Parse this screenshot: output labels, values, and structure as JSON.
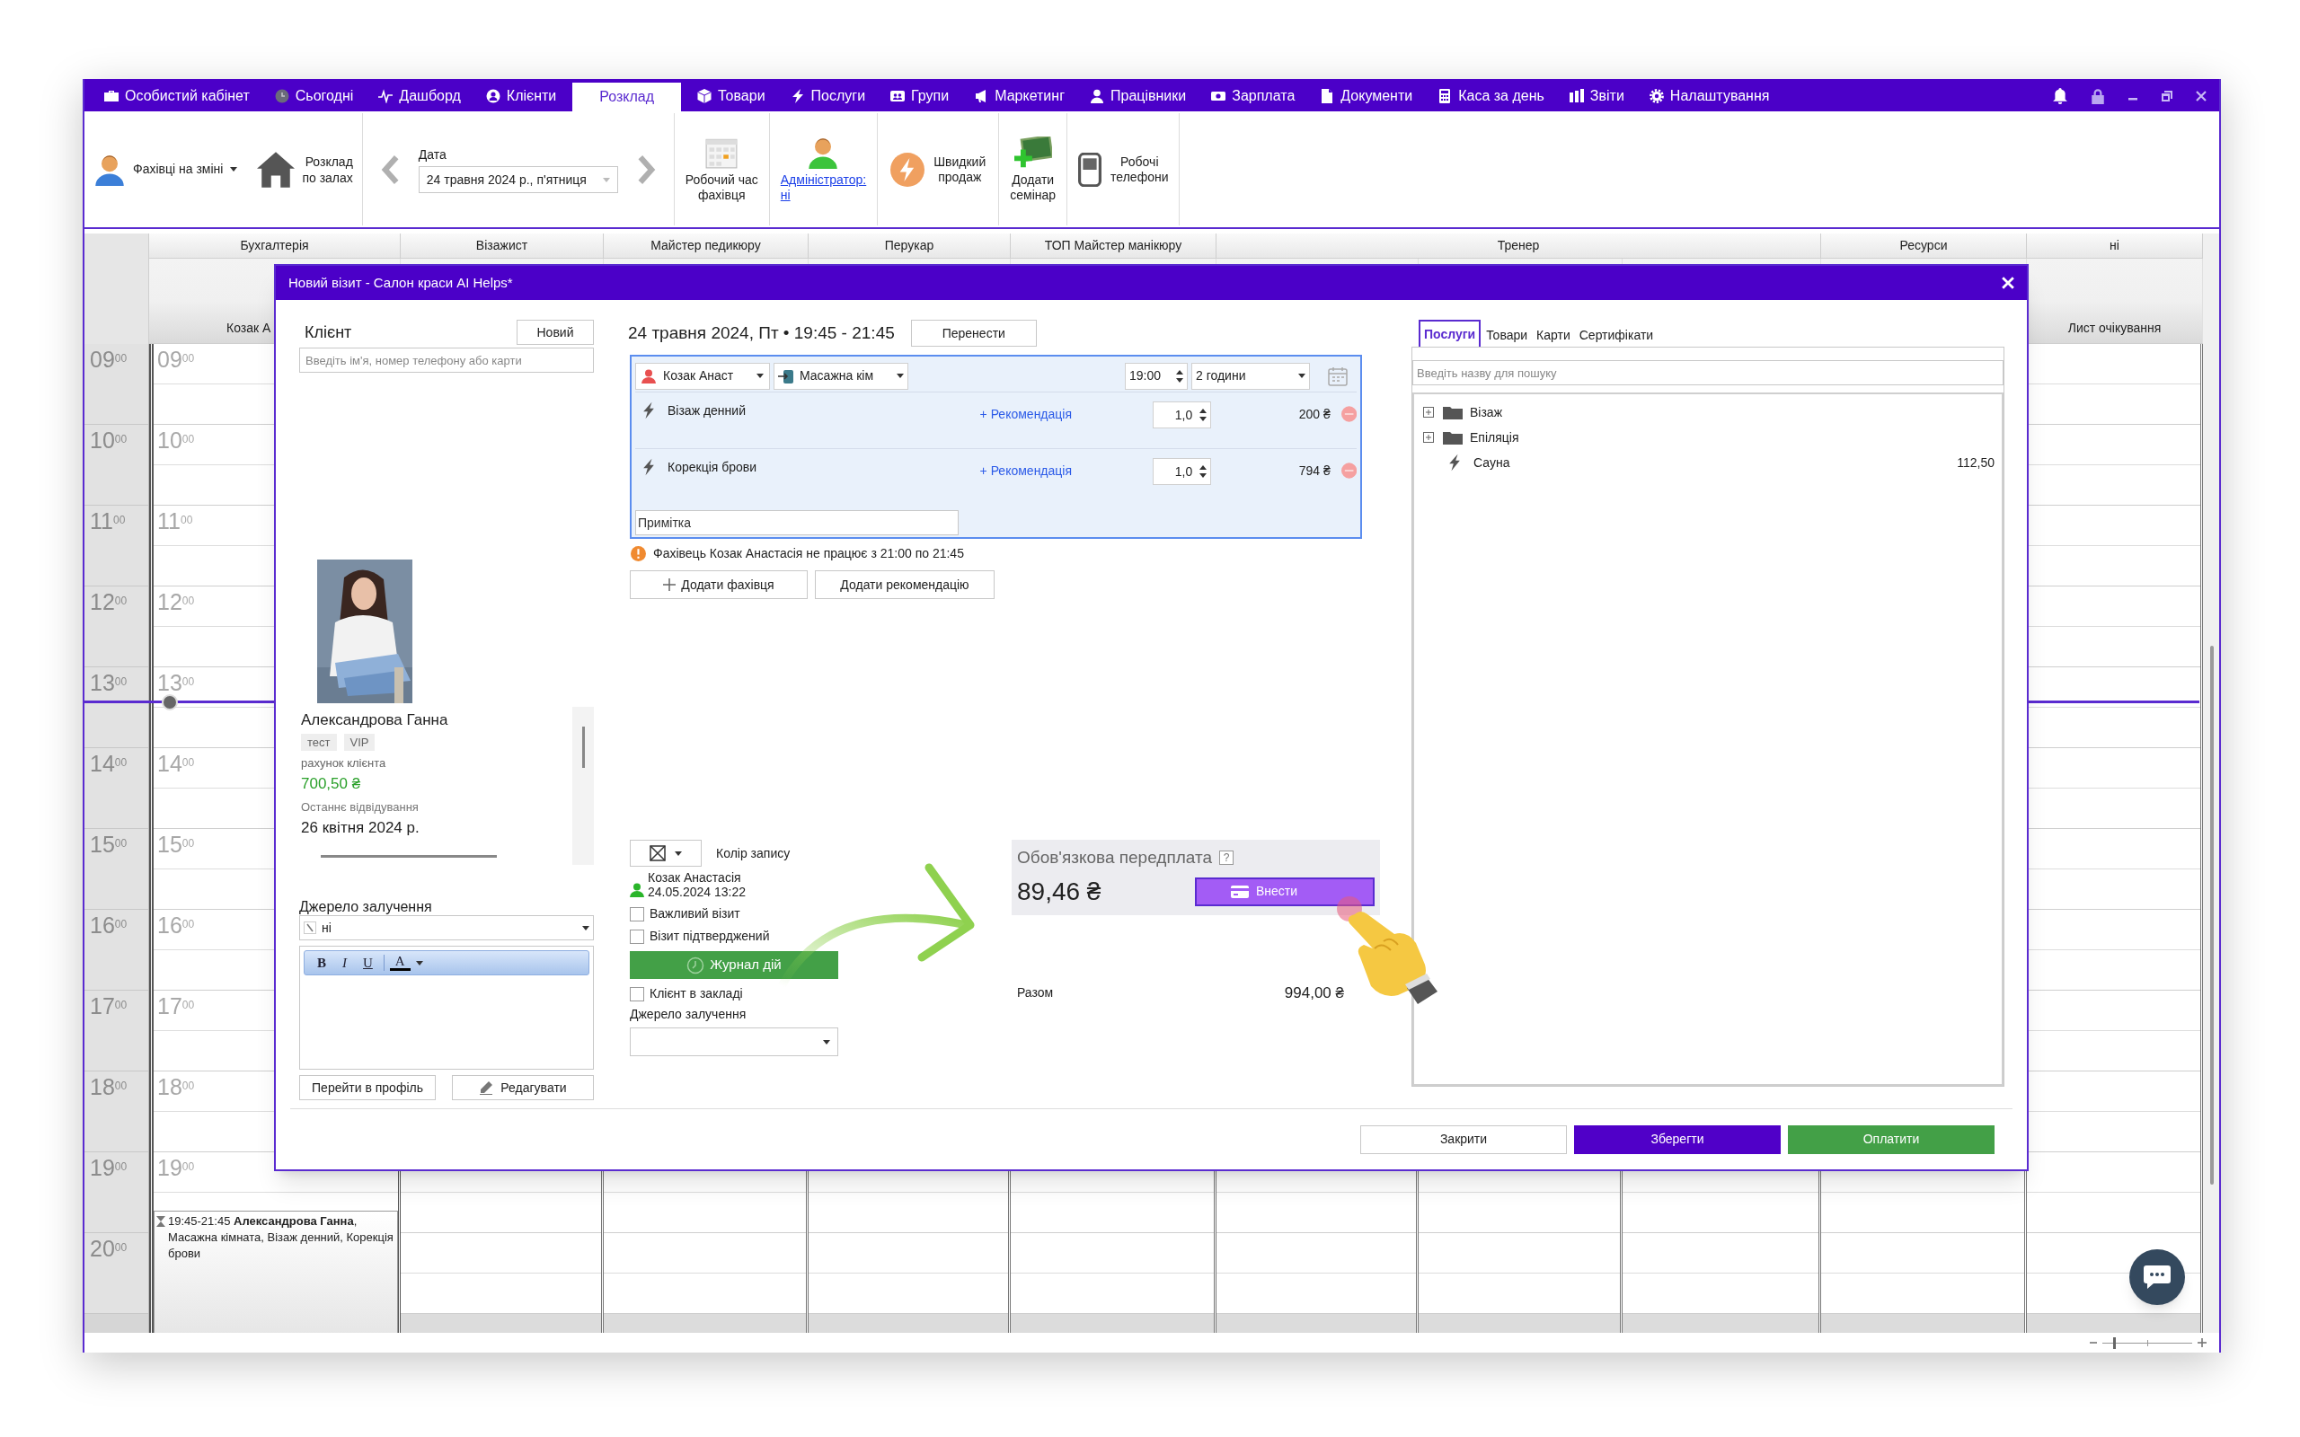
{
  "nav": {
    "items": [
      {
        "label": "Особистий кабінет",
        "selected": false
      },
      {
        "label": "Сьогодні",
        "selected": false
      },
      {
        "label": "Дашборд",
        "selected": false
      },
      {
        "label": "Клієнти",
        "selected": false
      },
      {
        "label": "Розклад",
        "selected": true
      },
      {
        "label": "Товари",
        "selected": false
      },
      {
        "label": "Послуги",
        "selected": false
      },
      {
        "label": "Групи",
        "selected": false
      },
      {
        "label": "Маркетинг",
        "selected": false
      },
      {
        "label": "Працівники",
        "selected": false
      },
      {
        "label": "Зарплата",
        "selected": false
      },
      {
        "label": "Документи",
        "selected": false
      },
      {
        "label": "Каса за день",
        "selected": false
      },
      {
        "label": "Звіти",
        "selected": false
      },
      {
        "label": "Налаштування",
        "selected": false
      }
    ]
  },
  "toolbar": {
    "specialists_button": "Фахівці на зміні",
    "halls_button": "Розклад\nпо залах",
    "date_label": "Дата",
    "date_value": "24 травня 2024 р., п'ятниця",
    "work_time_button": "Робочий час\nфахівця",
    "admin_link": "Адміністратор:\nні",
    "quick_sale_button": "Швидкий\nпродаж",
    "seminar_button": "Додати\nсемінар",
    "phones_button": "Робочі\nтелефони"
  },
  "calendar": {
    "columns": [
      "Бухгалтерія",
      "Візажист",
      "Майстер педикюру",
      "Перукар",
      "ТОП Майстер манікюру",
      "Тренер",
      "Ресурси",
      "ні"
    ],
    "first_subcolumn": "Козак А",
    "waiting_list": "Лист очікування",
    "gutter_hours": [
      "09$^{00}$",
      "10$^{00}$",
      "11$^{00}$",
      "12$^{00}$",
      "13$^{00}$",
      "14$^{00}$",
      "15$^{00}$",
      "16$^{00}$",
      "17$^{00}$",
      "18$^{00}$",
      "19$^{00}$",
      "20$^{00}$"
    ],
    "column_hours": [
      "09$^{00}$",
      "10$^{00}$",
      "11$^{00}$",
      "12$^{00}$",
      "13$^{00}$",
      "14$^{00}$",
      "15$^{00}$",
      "16$^{00}$",
      "17$^{00}$",
      "18$^{00}$",
      "19$^{00}$"
    ],
    "zoom": {
      "level": 0.12
    },
    "appointment": {
      "text": "19:45-21:45 **Александрова Ганна**, Масажна кімната, Візаж денний, Корекція брови"
    }
  },
  "dialog": {
    "title": "Новий візит - Салон краси AI Helps*",
    "client": {
      "heading": "Клієнт",
      "new_button": "Новий",
      "search_placeholder": "Введіть ім'я, номер телефону або карти",
      "name": "Александрова Ганна",
      "tags": [
        "тест",
        "VIP"
      ],
      "account_label": "рахунок клієнта",
      "account_value": "700,50 ₴",
      "last_visit_label": "Останнє відвідування",
      "last_visit_value": "26 квітня 2024 р.",
      "source_label": "Джерело залучення",
      "source_value": "ні",
      "editor_tools": [
        "B",
        "I",
        "U",
        "A"
      ],
      "profile_button": "Перейти в профіль",
      "edit_button": "Редагувати"
    },
    "visit": {
      "heading": "24 травня 2024, Пт • 19:45 - 21:45",
      "move_button": "Перенести",
      "specialist": "Козак Анаст",
      "room": "Масажна кім",
      "time": "19:00",
      "duration": "2 години",
      "services": [
        {
          "name": "Візаж денний",
          "recommendation": "+ Рекомендація",
          "quantity": "1,0",
          "price": "200 ₴"
        },
        {
          "name": "Корекція брови",
          "recommendation": "+ Рекомендація",
          "quantity": "1,0",
          "price": "794 ₴"
        }
      ],
      "note_placeholder": "Примітка",
      "warning": "Фахівець Козак Анастасія не працює з 21:00 по 21:45",
      "add_specialist_button": "Додати фахівця",
      "add_recommendation_button": "Додати рекомендацію",
      "color_label": "Колір запису",
      "creator_name": "Козак Анастасія",
      "created_at": "24.05.2024 13:22",
      "checkboxes": [
        {
          "label": "Важливий візит",
          "checked": false
        },
        {
          "label": "Візит підтверджений",
          "checked": false
        }
      ],
      "log_button": "Журнал дій",
      "client_present": {
        "label": "Клієнт в закладі",
        "checked": false
      },
      "source_label": "Джерело залучення",
      "prepayment": {
        "title": "Обов'язкова передплата",
        "help": "?",
        "amount": "89,46 ₴",
        "pay_button": "Внести"
      },
      "total_label": "Разом",
      "total_value": "994,00 ₴"
    },
    "catalog": {
      "tabs": [
        {
          "label": "Послуги",
          "selected": true
        },
        {
          "label": "Товари",
          "selected": false
        },
        {
          "label": "Карти",
          "selected": false
        },
        {
          "label": "Сертифікати",
          "selected": false
        }
      ],
      "search_placeholder": "Введіть назву для пошуку",
      "tree": [
        {
          "kind": "folder",
          "label": "Візаж",
          "expanded": false
        },
        {
          "kind": "folder",
          "label": "Епіляція",
          "expanded": false
        },
        {
          "kind": "service",
          "label": "Сауна",
          "price": "112,50"
        }
      ]
    },
    "buttons": {
      "close": "Закрити",
      "save": "Зберегти",
      "pay": "Оплатити"
    }
  }
}
